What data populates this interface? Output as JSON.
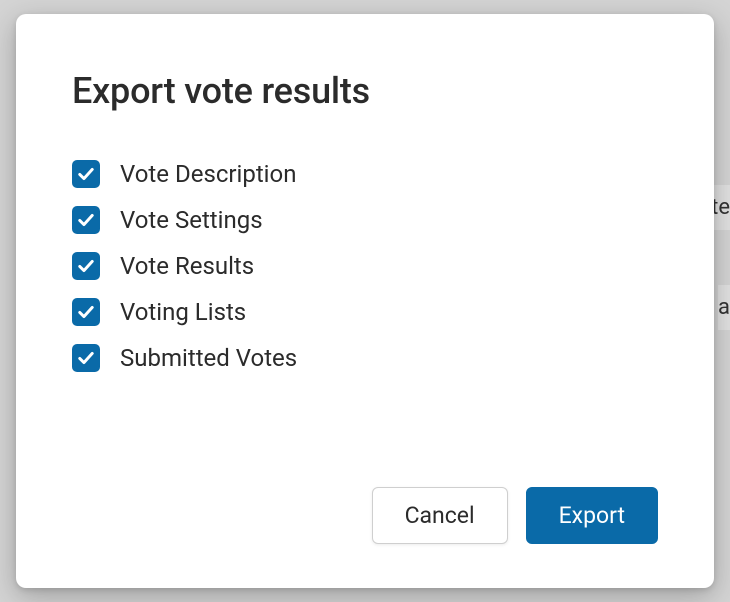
{
  "dialog": {
    "title": "Export vote results",
    "options": [
      {
        "label": "Vote Description",
        "checked": true
      },
      {
        "label": "Vote Settings",
        "checked": true
      },
      {
        "label": "Vote Results",
        "checked": true
      },
      {
        "label": "Voting Lists",
        "checked": true
      },
      {
        "label": "Submitted Votes",
        "checked": true
      }
    ],
    "buttons": {
      "cancel": "Cancel",
      "export": "Export"
    }
  },
  "colors": {
    "primary": "#0a6aa8"
  }
}
